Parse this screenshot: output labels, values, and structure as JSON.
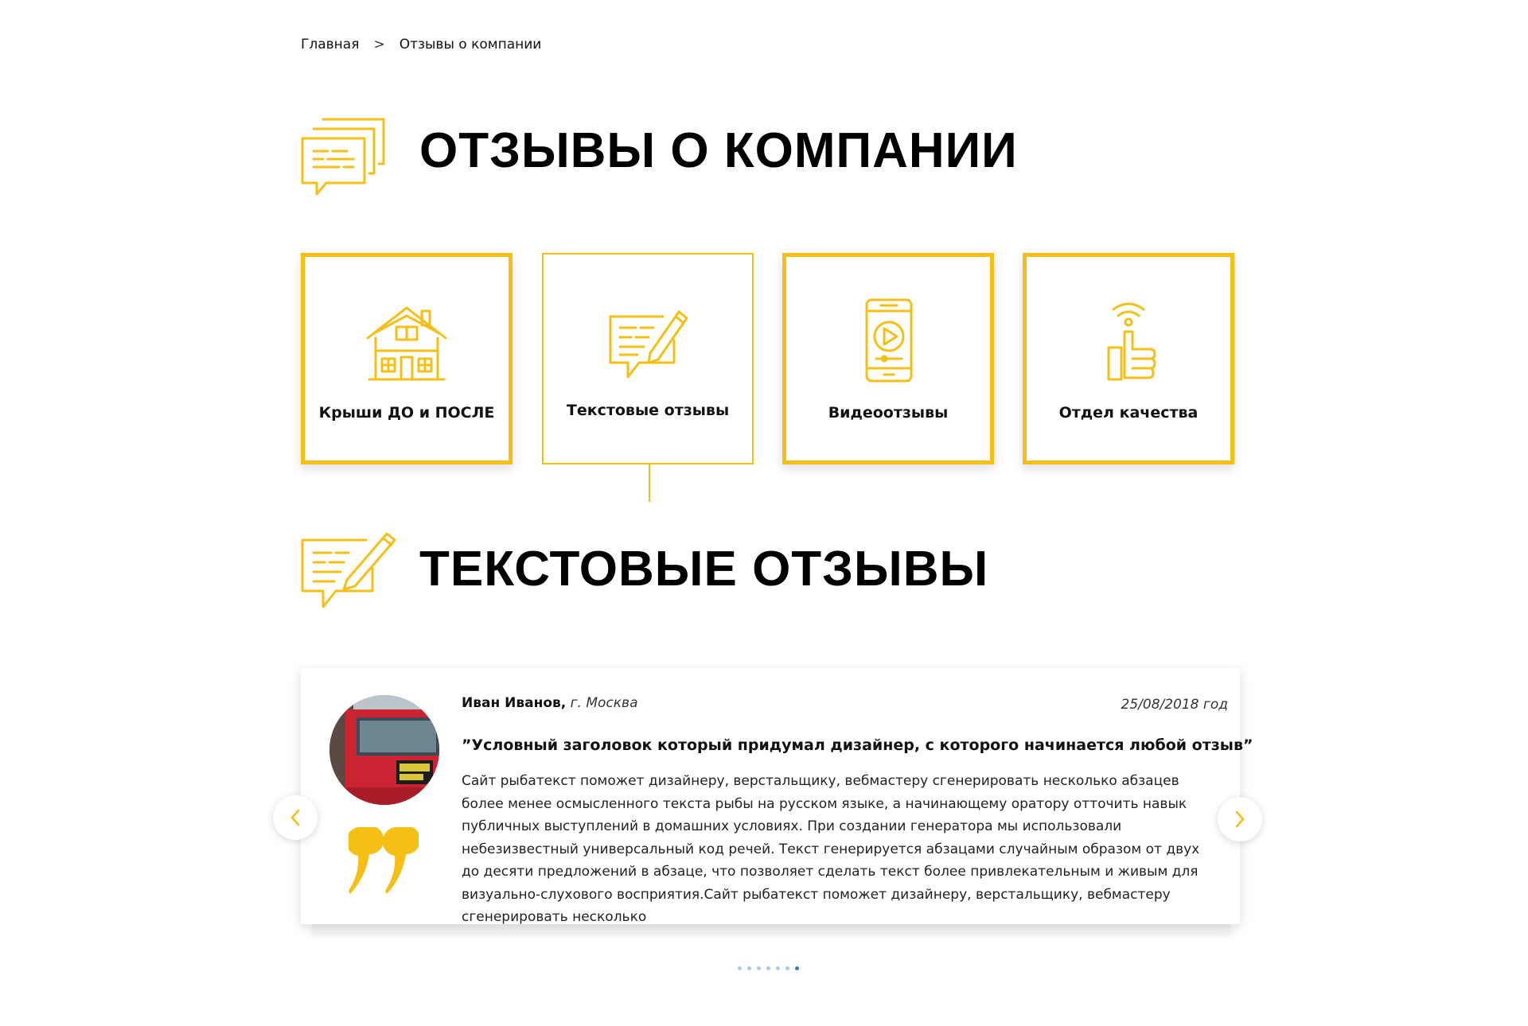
{
  "breadcrumb": {
    "home": "Главная",
    "separator": ">",
    "current": "Отзывы о компании"
  },
  "page_title": "ОТЗЫВЫ О КОМПАНИИ",
  "categories": [
    {
      "label": "Крыши ДО и ПОСЛЕ",
      "icon": "house-icon",
      "active": false
    },
    {
      "label": "Текстовые отзывы",
      "icon": "chat-pencil-icon",
      "active": true
    },
    {
      "label": "Видеоотзывы",
      "icon": "phone-play-icon",
      "active": false
    },
    {
      "label": "Отдел качества",
      "icon": "thumbs-up-wifi-icon",
      "active": false
    }
  ],
  "section_title": "ТЕКСТОВЫЕ ОТЗЫВЫ",
  "review": {
    "author": "Иван Иванов,",
    "city": "г. Москва",
    "date": "25/08/2018 год",
    "title": "”Условный заголовок который придумал дизайнер, с которого начинается любой отзыв”",
    "text": "Сайт рыбатекст поможет дизайнеру, верстальщику, вебмастеру сгенерировать несколько абзацев более менее осмысленного текста рыбы на русском языке, а начинающему оратору отточить навык публичных выступлений в домашних условиях. При создании генератора мы использовали небезизвестный универсальный код речей. Текст генерируется абзацами случайным образом от двух до десяти предложений в абзаце, что позволяет сделать текст более привлекательным и живым для визуально-слухового восприятия.Сайт рыбатекст поможет дизайнеру, верстальщику, вебмастеру сгенерировать несколько"
  },
  "slider": {
    "total_dots": 7,
    "active_dot": 7
  },
  "colors": {
    "accent": "#f5bf15",
    "dot": "#a9c7ec",
    "dot_active": "#3c78c8"
  }
}
